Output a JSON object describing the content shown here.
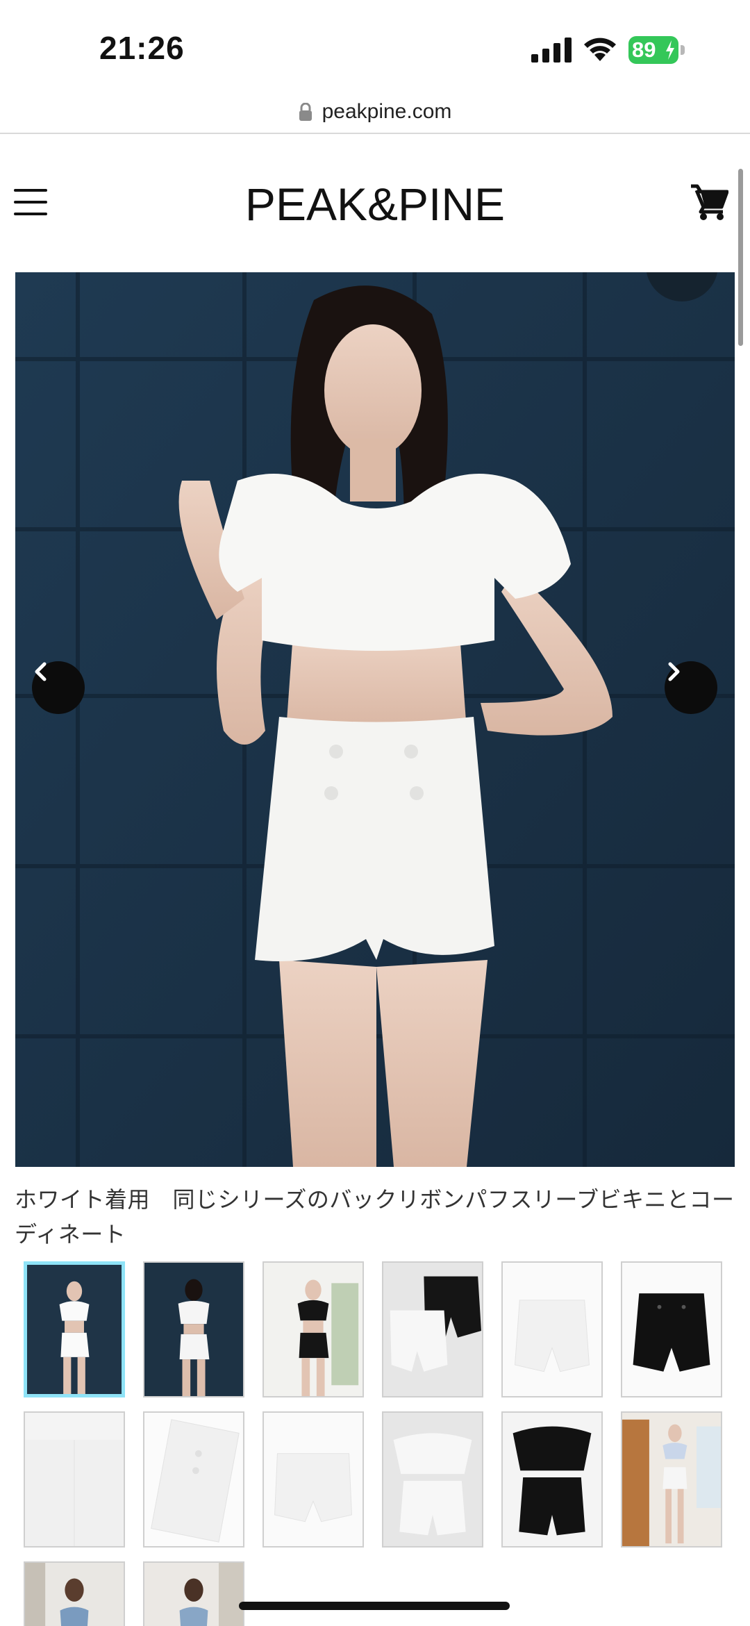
{
  "status_bar": {
    "time": "21:26",
    "battery_level": "89",
    "signal_icon": "cellular-signal-icon",
    "wifi_icon": "wifi-icon",
    "battery_icon": "battery-charging-icon"
  },
  "browser": {
    "url": "peakpine.com",
    "lock_icon": "lock-icon"
  },
  "header": {
    "logo": "PEAK&PINE",
    "menu_icon": "hamburger-menu-icon",
    "cart_icon": "shopping-cart-icon"
  },
  "gallery": {
    "prev_icon": "chevron-left-icon",
    "next_icon": "chevron-right-icon",
    "caption": "ホワイト着用　同じシリーズのバックリボンパフスリーブビキニとコーディネート",
    "thumbnails": [
      {
        "description": "model-white-front",
        "active": true
      },
      {
        "description": "model-white-back",
        "active": false
      },
      {
        "description": "model-black-front",
        "active": false
      },
      {
        "description": "shorts-black-white-flat",
        "active": false
      },
      {
        "description": "shorts-white-flat",
        "active": false
      },
      {
        "description": "shorts-black-flat",
        "active": false
      },
      {
        "description": "shorts-white-detail",
        "active": false
      },
      {
        "description": "shorts-white-buttons-detail",
        "active": false
      },
      {
        "description": "shorts-white-back",
        "active": false
      },
      {
        "description": "set-white-flat",
        "active": false
      },
      {
        "description": "set-black-flat",
        "active": false
      },
      {
        "description": "model-floral-set",
        "active": false
      },
      {
        "description": "model-floral-front",
        "active": false
      },
      {
        "description": "model-floral-back",
        "active": false
      }
    ]
  },
  "colors": {
    "background": "#ffffff",
    "hero_background": "#1b3248",
    "active_thumb_border": "#8fe3f7",
    "battery_green": "#34c759"
  }
}
